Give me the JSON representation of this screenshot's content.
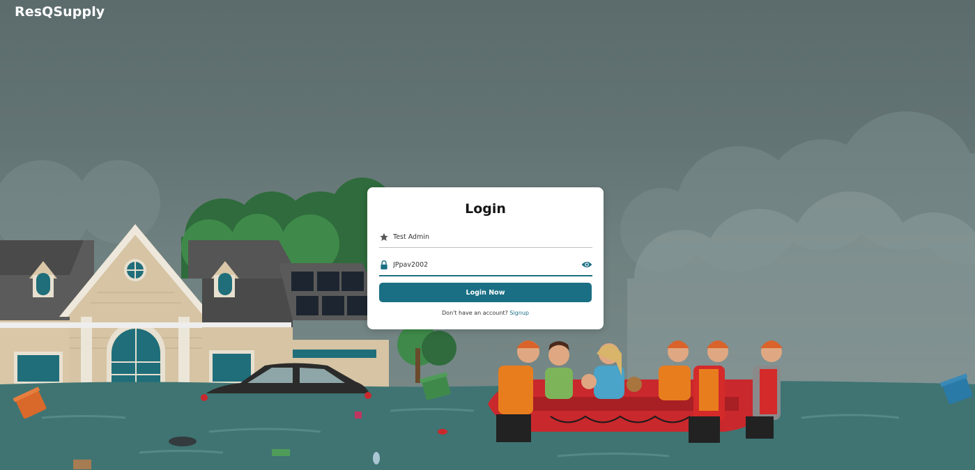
{
  "header": {
    "brand": "ResQSupply"
  },
  "login": {
    "title": "Login",
    "username": {
      "value": "Test Admin",
      "icon": "star-icon"
    },
    "password": {
      "value": "JPpav2002",
      "icon": "lock-icon",
      "toggle_icon": "eye-icon"
    },
    "submit_label": "Login Now",
    "signup_prompt": "Don't have an account?",
    "signup_link": "Signup"
  },
  "colors": {
    "accent": "#1a6f84",
    "water": "#3f7473",
    "sky": "#5f6f70"
  }
}
